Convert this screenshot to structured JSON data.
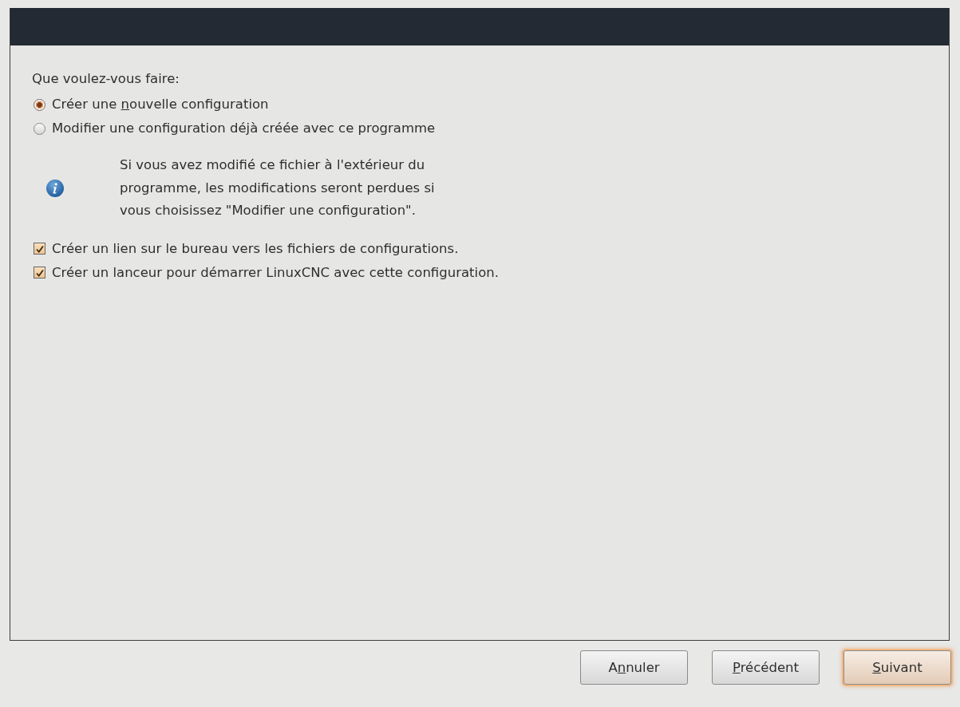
{
  "prompt": "Que voulez-vous faire:",
  "choices": [
    {
      "kind": "radio",
      "selected": true,
      "label": {
        "before": "Créer une ",
        "key": "n",
        "after": "ouvelle configuration"
      }
    },
    {
      "kind": "radio",
      "selected": false,
      "label": {
        "before": "Modifier une configuration déjà créée avec ce programme"
      }
    }
  ],
  "info": [
    "Si vous avez modifié ce fichier à l'extérieur du",
    "programme, les modifications seront perdues si",
    "vous choisissez \"Modifier une configuration\"."
  ],
  "options": [
    {
      "kind": "checkbox",
      "checked": true,
      "label": {
        "before": "Créer un lien sur le bureau vers les fichiers de configurations."
      }
    },
    {
      "kind": "checkbox",
      "checked": true,
      "label": {
        "before": "Créer un lanceur pour démarrer LinuxCNC avec cette configuration."
      }
    }
  ],
  "buttons": [
    {
      "label": {
        "before": "A",
        "key": "n",
        "after": "nuler"
      },
      "focused": false
    },
    {
      "label": {
        "key": "P",
        "after": "récédent"
      },
      "focused": false
    },
    {
      "label": {
        "key": "S",
        "after": "uivant"
      },
      "focused": true
    }
  ]
}
